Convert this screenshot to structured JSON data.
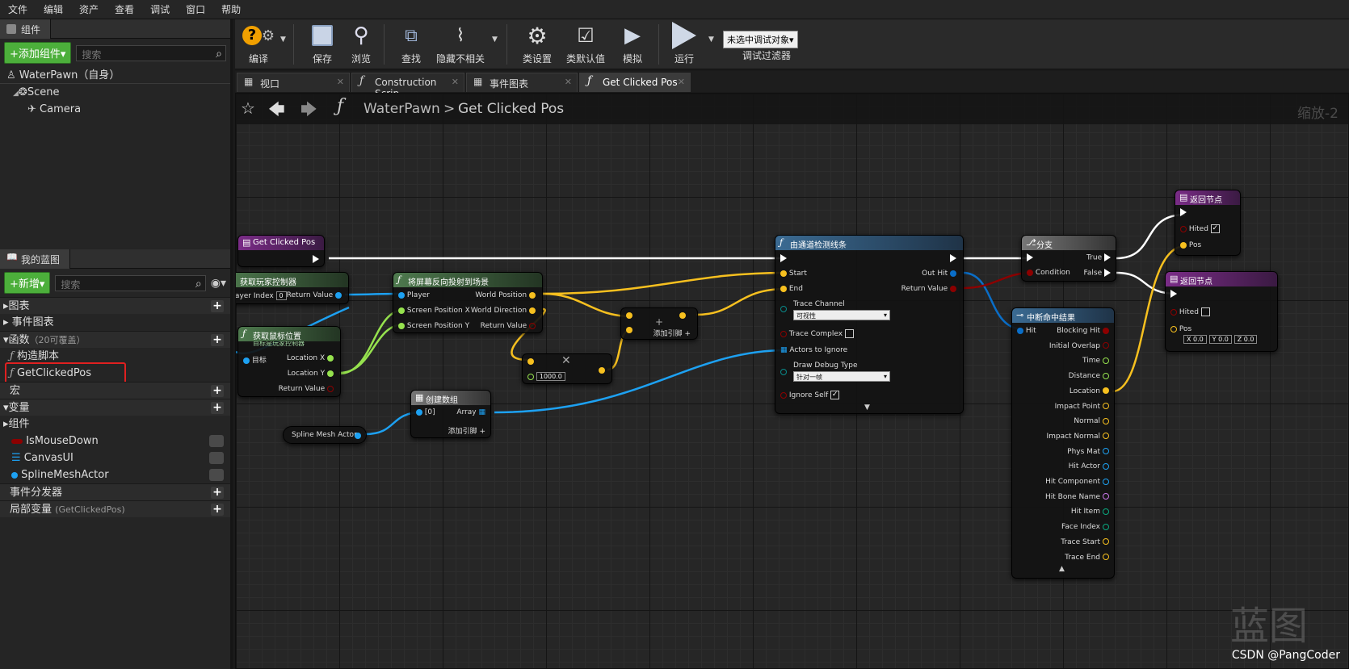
{
  "menubar": [
    "文件",
    "编辑",
    "资产",
    "查看",
    "调试",
    "窗口",
    "帮助"
  ],
  "components_panel": {
    "tab": "组件",
    "add_button": "+添加组件▾",
    "search_placeholder": "搜索",
    "self_item": "WaterPawn（自身）",
    "tree": [
      "Scene",
      "Camera"
    ]
  },
  "my_blueprint": {
    "tab": "我的蓝图",
    "new_button": "+新增▾",
    "search_placeholder": "搜索",
    "sections": {
      "graphs": "图表",
      "event_graph": "事件图表",
      "functions": "函数",
      "functions_note": "（20可覆盖）",
      "construct": "构造脚本",
      "selected_func": "GetClickedPos",
      "macros": "宏",
      "variables": "变量",
      "components": "组件",
      "var_items": [
        "IsMouseDown",
        "CanvasUI",
        "SplineMeshActor"
      ],
      "dispatchers": "事件分发器",
      "local_vars": "局部变量",
      "local_vars_note": "(GetClickedPos)"
    }
  },
  "toolbar": {
    "compile": "编译",
    "save": "保存",
    "browse": "浏览",
    "find": "查找",
    "hide_unrelated": "隐藏不相关",
    "class_settings": "类设置",
    "class_defaults": "类默认值",
    "simulate": "模拟",
    "play": "运行",
    "debug_target": "未选中调试对象▾",
    "debug_filter": "调试过滤器"
  },
  "doc_tabs": [
    "视口",
    "Construction Scrip",
    "事件图表",
    "Get Clicked Pos"
  ],
  "breadcrumb": {
    "root": "WaterPawn",
    "sep": ">",
    "leaf": "Get Clicked Pos"
  },
  "zoom": "缩放-2",
  "nodes": {
    "entry": {
      "title": "Get Clicked Pos"
    },
    "get_pc": {
      "title": "获取玩家控制器",
      "player_index": "Player Index",
      "player_index_val": "0",
      "ret": "Return Value"
    },
    "get_mouse": {
      "title": "获取鼠标位置",
      "sub": "目标是玩家控制器",
      "target": "目标",
      "lx": "Location X",
      "ly": "Location Y",
      "ret": "Return Value"
    },
    "deproject": {
      "title": "将屏幕反向投射到场景",
      "player": "Player",
      "sx": "Screen Position X",
      "sy": "Screen Position Y",
      "wp": "World Position",
      "wd": "World Direction",
      "ret": "Return Value"
    },
    "multiply": {
      "value": "1000.0"
    },
    "add": {
      "add_pin": "添加引脚"
    },
    "make_array": {
      "title": "创建数组",
      "idx": "[0]",
      "arr": "Array",
      "add_pin": "添加引脚"
    },
    "spline_var": {
      "label": "Spline Mesh Actor"
    },
    "trace": {
      "title": "由通道检测线条",
      "start": "Start",
      "end": "End",
      "channel": "Trace Channel",
      "channel_val": "可视性",
      "complex": "Trace Complex",
      "ignore": "Actors to Ignore",
      "debug": "Draw Debug Type",
      "debug_val": "针对一帧",
      "self": "Ignore Self",
      "out_hit": "Out Hit",
      "ret": "Return Value"
    },
    "branch": {
      "title": "分支",
      "cond": "Condition",
      "t": "True",
      "f": "False"
    },
    "return1": {
      "title": "返回节点",
      "hited": "Hited",
      "pos": "Pos"
    },
    "return2": {
      "title": "返回节点",
      "hited": "Hited",
      "pos": "Pos",
      "x": "X",
      "xv": "0.0",
      "y": "Y",
      "yv": "0.0",
      "z": "Z",
      "zv": "0.0"
    },
    "break_hit": {
      "title": "中断命中结果",
      "hit": "Hit",
      "outs": [
        "Blocking Hit",
        "Initial Overlap",
        "Time",
        "Distance",
        "Location",
        "Impact Point",
        "Normal",
        "Impact Normal",
        "Phys Mat",
        "Hit Actor",
        "Hit Component",
        "Hit Bone Name",
        "Hit Item",
        "Face Index",
        "Trace Start",
        "Trace End"
      ]
    }
  },
  "watermark": {
    "big": "蓝图",
    "credit": "CSDN @PangCoder"
  },
  "colors": {
    "exec": "#ffffff",
    "vector": "#f7c01f",
    "float": "#96e24e",
    "object": "#1da1f2",
    "bool": "#8c0000",
    "struct": "#0a6ec8",
    "highlight_box": "#e02020"
  }
}
